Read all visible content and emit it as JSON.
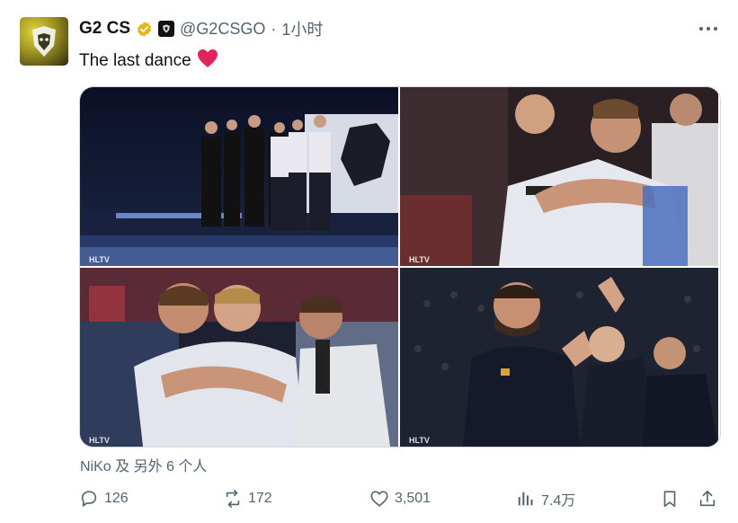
{
  "tweet": {
    "author_name": "G2 CS",
    "handle": "@G2CSGO",
    "separator": "·",
    "time": "1小时",
    "text": "The last dance",
    "verified_color": "#e2b719",
    "heart_color": "#e0245e"
  },
  "media": {
    "watermark": "HLTV",
    "photos": [
      {
        "name": "team-walkout-photo"
      },
      {
        "name": "players-hug-photo"
      },
      {
        "name": "players-embrace-photo"
      },
      {
        "name": "coach-applause-photo"
      }
    ]
  },
  "social_context": {
    "liked_by": "NiKo 及 另外 6 个人"
  },
  "actions": {
    "replies": "126",
    "reposts": "172",
    "likes": "3,501",
    "views": "7.4万"
  }
}
